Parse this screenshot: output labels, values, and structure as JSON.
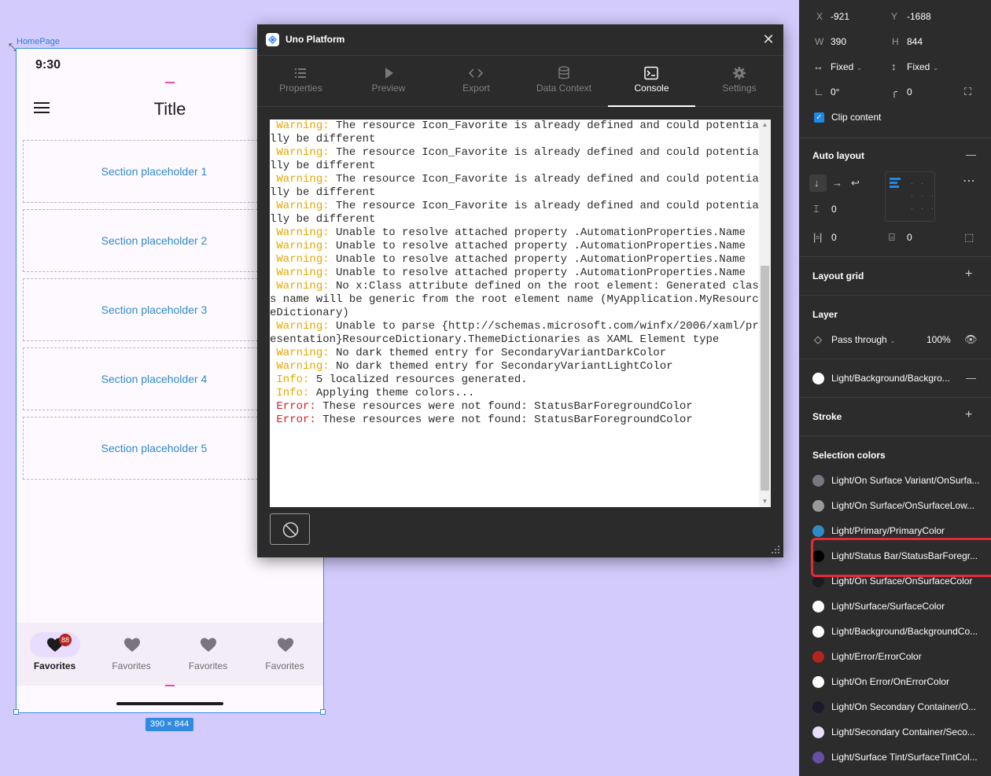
{
  "canvas": {
    "frame_label": "HomePage",
    "size_badge": "390 × 844"
  },
  "phone": {
    "status_time": "9:30",
    "title": "Title",
    "sections": [
      "Section placeholder 1",
      "Section placeholder 2",
      "Section placeholder 3",
      "Section placeholder 4",
      "Section placeholder 5"
    ],
    "nav": [
      {
        "label": "Favorites",
        "active": true,
        "badge": "88"
      },
      {
        "label": "Favorites",
        "active": false
      },
      {
        "label": "Favorites",
        "active": false
      },
      {
        "label": "Favorites",
        "active": false
      }
    ]
  },
  "plugin": {
    "title": "Uno Platform",
    "tabs": [
      {
        "label": "Properties",
        "icon": "list-icon"
      },
      {
        "label": "Preview",
        "icon": "play-icon"
      },
      {
        "label": "Export",
        "icon": "code-icon"
      },
      {
        "label": "Data Context",
        "icon": "database-icon"
      },
      {
        "label": "Console",
        "icon": "terminal-icon",
        "active": true
      },
      {
        "label": "Settings",
        "icon": "gear-icon"
      }
    ],
    "console_lines": [
      {
        "level": "Warning:",
        "text": " The resource Icon_Favorite is already defined and could potentially be different"
      },
      {
        "level": "Warning:",
        "text": " The resource Icon_Favorite is already defined and could potentially be different"
      },
      {
        "level": "Warning:",
        "text": " The resource Icon_Favorite is already defined and could potentially be different"
      },
      {
        "level": "Warning:",
        "text": " The resource Icon_Favorite is already defined and could potentially be different"
      },
      {
        "level": "Warning:",
        "text": " Unable to resolve attached property .AutomationProperties.Name"
      },
      {
        "level": "Warning:",
        "text": " Unable to resolve attached property .AutomationProperties.Name"
      },
      {
        "level": "Warning:",
        "text": " Unable to resolve attached property .AutomationProperties.Name"
      },
      {
        "level": "Warning:",
        "text": " Unable to resolve attached property .AutomationProperties.Name"
      },
      {
        "level": "Warning:",
        "text": " No x:Class attribute defined on the root element: Generated class name will be generic from the root element name (MyApplication.MyResourceDictionary)"
      },
      {
        "level": "Warning:",
        "text": " Unable to parse {http://schemas.microsoft.com/winfx/2006/xaml/presentation}ResourceDictionary.ThemeDictionaries as XAML Element type"
      },
      {
        "level": "Warning:",
        "text": " No dark themed entry for SecondaryVariantDarkColor"
      },
      {
        "level": "Warning:",
        "text": " No dark themed entry for SecondaryVariantLightColor"
      },
      {
        "level": "Info:",
        "text": " 5 localized resources generated."
      },
      {
        "level": "Info:",
        "text": " Applying theme colors..."
      },
      {
        "level": "Error:",
        "text": " These resources were not found: StatusBarForegroundColor"
      },
      {
        "level": "Error:",
        "text": " These resources were not found: StatusBarForegroundColor"
      }
    ],
    "clear_icon": "clear-icon"
  },
  "panel": {
    "x_label": "X",
    "x_value": "-921",
    "y_label": "Y",
    "y_value": "-1688",
    "w_label": "W",
    "w_value": "390",
    "h_label": "H",
    "h_value": "844",
    "width_mode": "Fixed",
    "height_mode": "Fixed",
    "rotation": "0°",
    "radius": "0",
    "clip_content": "Clip content",
    "auto_layout": {
      "heading": "Auto layout",
      "spacing": "0",
      "padding_h": "0",
      "padding_v": "0"
    },
    "layout_grid": "Layout grid",
    "layer": {
      "heading": "Layer",
      "blend": "Pass through",
      "opacity": "100%"
    },
    "fill": {
      "label": "Light/Background/Backgro...",
      "color": "#ffffff"
    },
    "stroke": "Stroke",
    "selection_colors": {
      "heading": "Selection colors",
      "items": [
        {
          "label": "Light/On Surface Variant/OnSurfa...",
          "color": "#7a757f"
        },
        {
          "label": "Light/On Surface/OnSurfaceLow...",
          "color": "#9a9a9a"
        },
        {
          "label": "Light/Primary/PrimaryColor",
          "color": "#2f8ac9"
        },
        {
          "label": "Light/Status Bar/StatusBarForegr...",
          "color": "#000000"
        },
        {
          "label": "Light/On Surface/OnSurfaceColor",
          "color": "#1c1b1f"
        },
        {
          "label": "Light/Surface/SurfaceColor",
          "color": "#ffffff"
        },
        {
          "label": "Light/Background/BackgroundCo...",
          "color": "#ffffff"
        },
        {
          "label": "Light/Error/ErrorColor",
          "color": "#b3261e"
        },
        {
          "label": "Light/On Error/OnErrorColor",
          "color": "#ffffff"
        },
        {
          "label": "Light/On Secondary Container/O...",
          "color": "#1d192b"
        },
        {
          "label": "Light/Secondary Container/Seco...",
          "color": "#e8def8"
        },
        {
          "label": "Light/Surface Tint/SurfaceTintCol...",
          "color": "#6750a4"
        }
      ]
    }
  }
}
